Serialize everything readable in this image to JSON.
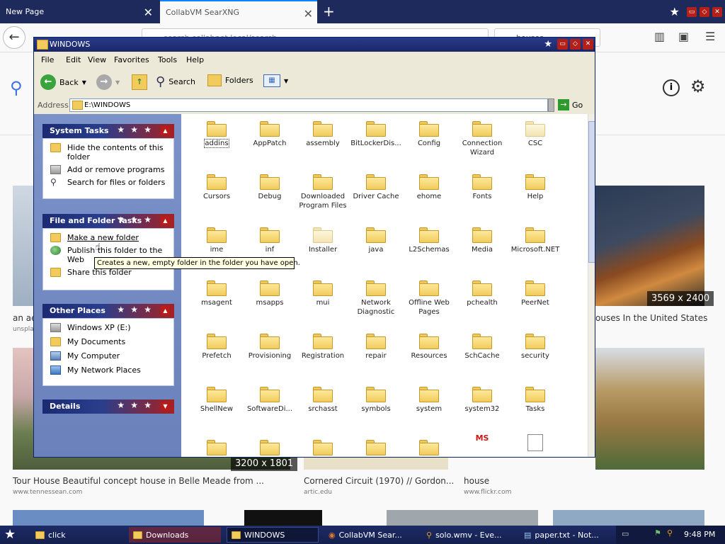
{
  "browser": {
    "tabs": [
      {
        "label": "New Page"
      },
      {
        "label": "CollabVM SearXNG"
      }
    ],
    "url": "search.collabnet.local/search",
    "search_value": "houses"
  },
  "page": {
    "results": [
      {
        "dim": "3569 x 2400",
        "title": "ouses In the United States",
        "src": ""
      },
      {
        "dim": "3200 x 1801",
        "title": "Tour House Beautiful concept house in Belle Meade from ...",
        "src": "www.tennessean.com"
      },
      {
        "dim": "",
        "title": "Cornered Circuit (1970) // Gordon...",
        "src": "artic.edu"
      },
      {
        "dim": "",
        "title": "house",
        "src": "www.flickr.com"
      },
      {
        "dim": "",
        "title": "an ae",
        "src": "unspla"
      }
    ]
  },
  "explorer": {
    "title": "WINDOWS",
    "menu": [
      "File",
      "Edit",
      "View",
      "Favorites",
      "Tools",
      "Help"
    ],
    "toolbar": {
      "back": "Back",
      "search": "Search",
      "folders": "Folders"
    },
    "address_label": "Address",
    "address_value": "E:\\WINDOWS",
    "go_label": "Go",
    "panels": {
      "system_tasks": {
        "title": "System Tasks",
        "items": [
          "Hide the contents of this folder",
          "Add or remove programs",
          "Search for files or folders"
        ]
      },
      "file_folder_tasks": {
        "title": "File and Folder Tasks",
        "items": [
          "Make a new folder",
          "Publish this folder to the Web",
          "Share this folder"
        ]
      },
      "other_places": {
        "title": "Other Places",
        "items": [
          "Windows XP (E:)",
          "My Documents",
          "My Computer",
          "My Network Places"
        ]
      },
      "details": {
        "title": "Details"
      }
    },
    "tooltip": "Creates a new, empty folder in the folder you have open.",
    "folders": [
      "addins",
      "AppPatch",
      "assembly",
      "BitLockerDis...",
      "Config",
      "Connection Wizard",
      "CSC",
      "Cursors",
      "Debug",
      "Downloaded Program Files",
      "Driver Cache",
      "ehome",
      "Fonts",
      "Help",
      "ime",
      "inf",
      "Installer",
      "java",
      "L2Schemas",
      "Media",
      "Microsoft.NET",
      "msagent",
      "msapps",
      "mui",
      "Network Diagnostic",
      "Offline Web Pages",
      "pchealth",
      "PeerNet",
      "Prefetch",
      "Provisioning",
      "Registration",
      "repair",
      "Resources",
      "SchCache",
      "security",
      "ShellNew",
      "SoftwareDi...",
      "srchasst",
      "symbols",
      "system",
      "system32",
      "Tasks"
    ],
    "ms_icon_label": "MS"
  },
  "taskbar": {
    "buttons": [
      "click",
      "Downloads",
      "WINDOWS",
      "CollabVM Sear...",
      "solo.wmv - Eve...",
      "paper.txt - Not..."
    ],
    "clock": "9:48 PM"
  },
  "colors": {
    "titlebar": "#1b2766",
    "panel_head_start": "#1b2a72",
    "panel_head_end": "#a82020",
    "taskpane_bg": "#7b92c9",
    "folder": "#f1cc5c"
  }
}
